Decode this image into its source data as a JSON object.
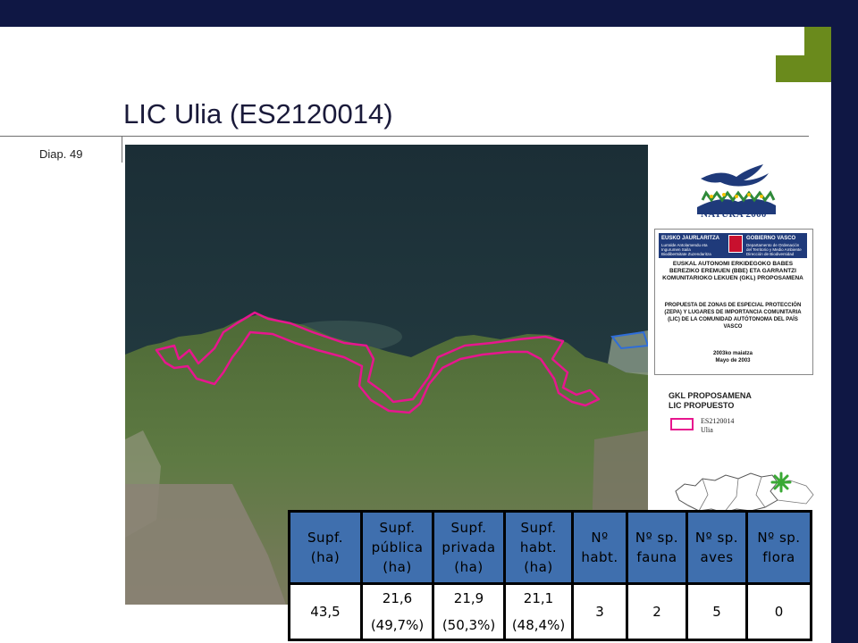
{
  "slide": {
    "title": "LIC Ulia (ES2120014)",
    "number_label": "Diap. 49"
  },
  "natura_logo": {
    "text": "NATURA 2000",
    "icon": "natura-2000-birds-icon"
  },
  "government_box": {
    "header_left": "EUSKO JAURLARITZA",
    "header_right": "GOBIERNO VASCO",
    "dept_eu": "Lurralde Antolamendu eta Ingurumen Saila Biodibertsitate Zuzendaritza",
    "dept_es": "Departamento de Ordenación del Territorio y Medio Ambiente Dirección de Biodiversidad",
    "proposal_eu": "EUSKAL AUTONOMI ERKIDEGOKO BABES BEREZIKO EREMUEN (BBE) ETA GARRANTZI KOMUNITARIOKO LEKUEN (GKL) PROPOSAMENA",
    "proposal_es": "PROPUESTA DE ZONAS DE ESPECIAL PROTECCIÓN (ZEPA) Y LUGARES DE IMPORTANCIA COMUNITARIA (LIC) DE LA COMUNIDAD AUTÓTONOMA DEL PAÍS VASCO",
    "date_eu": "2003ko maiatza",
    "date_es": "Mayo de 2003"
  },
  "legend": {
    "title_line1": "GKL PROPOSAMENA",
    "title_line2": "LIC PROPUESTO",
    "code": "ES2120014",
    "name": "Ulia",
    "boundary_color": "#e7168e"
  },
  "table": {
    "header_color": "#3f6fae",
    "headers": [
      [
        "Supf.",
        "(ha)",
        ""
      ],
      [
        "Supf.",
        "pública",
        "(ha)"
      ],
      [
        "Supf.",
        "privada",
        "(ha)"
      ],
      [
        "Supf.",
        "habt.",
        "(ha)"
      ],
      [
        "Nº",
        "habt.",
        ""
      ],
      [
        "Nº sp.",
        "fauna",
        ""
      ],
      [
        "Nº sp.",
        "aves",
        ""
      ],
      [
        "Nº sp.",
        "flora",
        ""
      ]
    ],
    "values": [
      [
        "43,5",
        ""
      ],
      [
        "21,6",
        "(49,7%)"
      ],
      [
        "21,9",
        "(50,3%)"
      ],
      [
        "21,1",
        "(48,4%)"
      ],
      [
        "3",
        ""
      ],
      [
        "2",
        ""
      ],
      [
        "5",
        ""
      ],
      [
        "0",
        ""
      ]
    ]
  }
}
